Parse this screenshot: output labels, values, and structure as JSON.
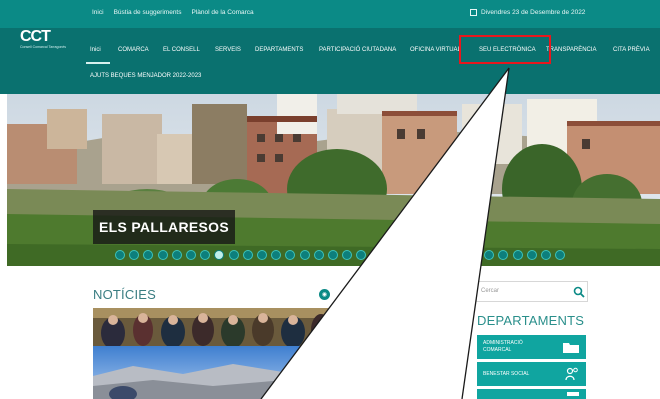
{
  "topbar": {
    "links": [
      "Inici",
      "Bústia de suggeriments",
      "Plànol de la Comarca"
    ],
    "date": "Divendres 23 de Desembre de 2022"
  },
  "logo": {
    "text": "CCT",
    "subtitle": "Consell Comarcal Tarragonès"
  },
  "nav": {
    "items": [
      "Inici",
      "COMARCA",
      "EL CONSELL",
      "SERVEIS",
      "DEPARTAMENTS",
      "PARTICIPACIÓ CIUTADANA",
      "OFICINA VIRTUAL",
      "SEU ELECTRÒNICA",
      "TRANSPARÈNCIA",
      "CITA PRÈVIA"
    ],
    "second_row": "AJUTS BEQUES MENJADOR 2022-2023",
    "active": "Inici",
    "highlighted": "SEU ELECTRÒNICA"
  },
  "hero": {
    "caption": "ELS PALLARESOS",
    "dots": 32,
    "active_dot": 7
  },
  "news": {
    "title": "NOTÍCIES"
  },
  "search": {
    "placeholder": "Cercar"
  },
  "departments": {
    "title": "DEPARTAMENTS",
    "items": [
      {
        "label": "ADMINISTRACIÓ COMARCAL",
        "icon": "folder-icon"
      },
      {
        "label": "BENESTAR SOCIAL",
        "icon": "people-icon"
      },
      {
        "label": "",
        "icon": "tray-icon"
      }
    ]
  },
  "colors": {
    "topbar": "#0b8a86",
    "navbar": "#0a716f",
    "accent": "#10a5a0",
    "highlight": "#e8171d"
  }
}
